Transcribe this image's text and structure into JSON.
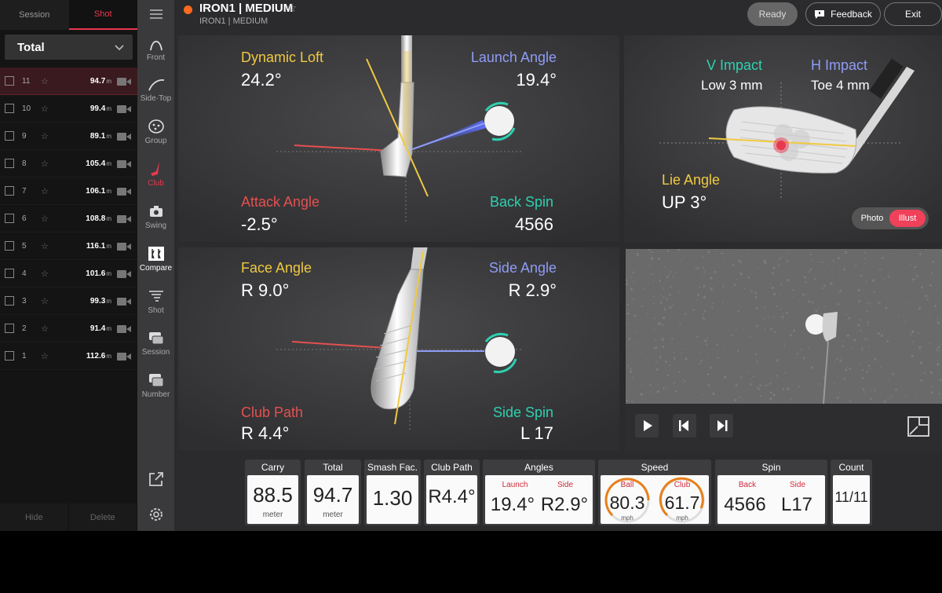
{
  "left_panel": {
    "tabs": [
      "Session",
      "Shot"
    ],
    "filter": "Total",
    "shots": [
      {
        "num": "11",
        "dist": "94.7",
        "unit": "m"
      },
      {
        "num": "10",
        "dist": "99.4",
        "unit": "m"
      },
      {
        "num": "9",
        "dist": "89.1",
        "unit": "m"
      },
      {
        "num": "8",
        "dist": "105.4",
        "unit": "m"
      },
      {
        "num": "7",
        "dist": "106.1",
        "unit": "m"
      },
      {
        "num": "6",
        "dist": "108.8",
        "unit": "m"
      },
      {
        "num": "5",
        "dist": "116.1",
        "unit": "m"
      },
      {
        "num": "4",
        "dist": "101.6",
        "unit": "m"
      },
      {
        "num": "3",
        "dist": "99.3",
        "unit": "m"
      },
      {
        "num": "2",
        "dist": "91.4",
        "unit": "m"
      },
      {
        "num": "1",
        "dist": "112.6",
        "unit": "m"
      }
    ],
    "hide": "Hide",
    "delete": "Delete"
  },
  "nav": {
    "front": "Front",
    "sidetop": "Side·Top",
    "group": "Group",
    "club": "Club",
    "swing": "Swing",
    "compare": "Compare",
    "shot": "Shot",
    "session": "Session",
    "number": "Number"
  },
  "header": {
    "title": "IRON1 | MEDIUM",
    "subtitle": "IRON1 | MEDIUM",
    "ready": "Ready",
    "feedback": "Feedback",
    "exit": "Exit"
  },
  "panel1": {
    "dynamic_loft_label": "Dynamic Loft",
    "dynamic_loft": "24.2°",
    "launch_angle_label": "Launch Angle",
    "launch_angle": "19.4°",
    "attack_angle_label": "Attack Angle",
    "attack_angle": "-2.5°",
    "back_spin_label": "Back Spin",
    "back_spin": "4566"
  },
  "panel2": {
    "v_impact_label": "V Impact",
    "v_impact": "Low 3 mm",
    "h_impact_label": "H Impact",
    "h_impact": "Toe 4 mm",
    "lie_angle_label": "Lie Angle",
    "lie_angle": "UP 3°",
    "photo": "Photo",
    "illust": "Illust"
  },
  "panel3": {
    "face_angle_label": "Face Angle",
    "face_angle": "R 9.0°",
    "side_angle_label": "Side Angle",
    "side_angle": "R 2.9°",
    "club_path_label": "Club Path",
    "club_path": "R 4.4°",
    "side_spin_label": "Side Spin",
    "side_spin": "L 17"
  },
  "stats": {
    "carry": {
      "label": "Carry",
      "value": "88.5",
      "unit": "meter"
    },
    "total": {
      "label": "Total",
      "value": "94.7",
      "unit": "meter"
    },
    "smash": {
      "label": "Smash Fac.",
      "value": "1.30"
    },
    "clubpath": {
      "label": "Club Path",
      "value": "R4.4°"
    },
    "angles": {
      "label": "Angles",
      "launch_label": "Launch",
      "launch": "19.4°",
      "side_label": "Side",
      "side": "R2.9°"
    },
    "speed": {
      "label": "Speed",
      "ball_label": "Ball",
      "ball": "80.3",
      "club_label": "Club",
      "club": "61.7",
      "unit": "mph"
    },
    "spin": {
      "label": "Spin",
      "back_label": "Back",
      "back": "4566",
      "side_label": "Side",
      "side": "L17"
    },
    "count": {
      "label": "Count",
      "value": "11/11"
    }
  },
  "colors": {
    "accent": "#e8384f",
    "yellow": "#f0c940",
    "blue": "#8f9cf5",
    "red": "#e55050",
    "teal": "#2ed0b0",
    "orange": "#ff6a20"
  }
}
